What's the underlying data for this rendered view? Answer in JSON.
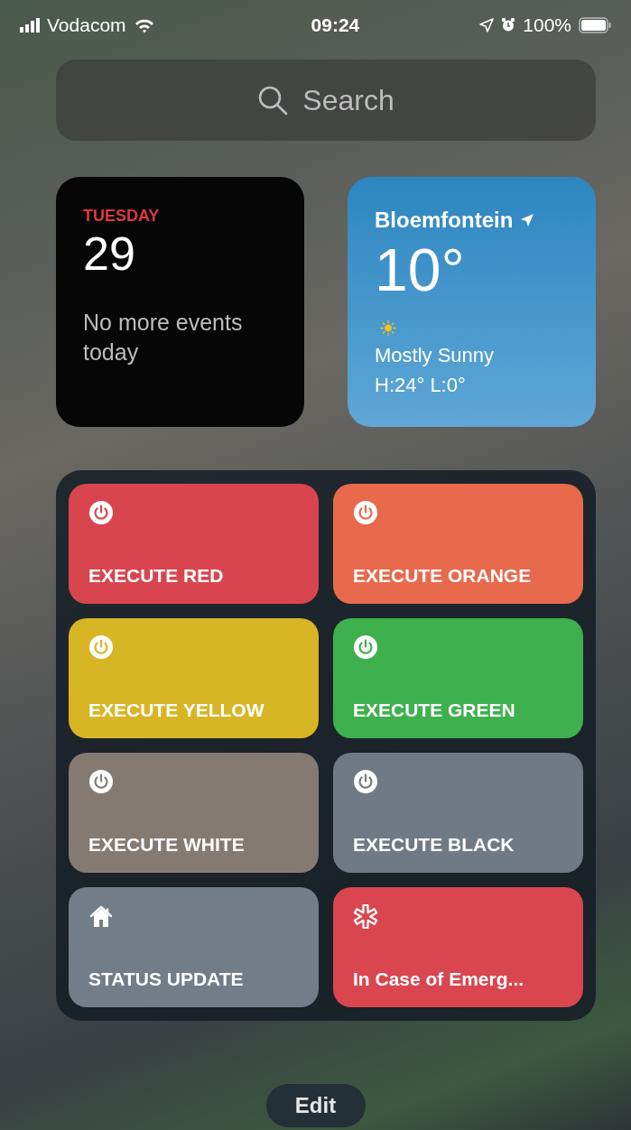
{
  "status_bar": {
    "carrier": "Vodacom",
    "time": "09:24",
    "battery": "100%"
  },
  "search": {
    "placeholder": "Search"
  },
  "calendar": {
    "day": "TUESDAY",
    "date": "29",
    "message": "No more events today"
  },
  "weather": {
    "city": "Bloemfontein",
    "temperature": "10°",
    "condition": "Mostly Sunny",
    "high_low": "H:24° L:0°"
  },
  "shortcuts": [
    {
      "label": "EXECUTE RED",
      "kind": "power",
      "color": "#d9454f"
    },
    {
      "label": "EXECUTE ORANGE",
      "kind": "power",
      "color": "#e8694c"
    },
    {
      "label": "EXECUTE YELLOW",
      "kind": "power",
      "color": "#d8b524"
    },
    {
      "label": "EXECUTE GREEN",
      "kind": "power",
      "color": "#3fb04e"
    },
    {
      "label": "EXECUTE WHITE",
      "kind": "power",
      "color": "#857a72"
    },
    {
      "label": "EXECUTE BLACK",
      "kind": "power",
      "color": "#6f7a85"
    },
    {
      "label": "STATUS UPDATE",
      "kind": "home",
      "color": "#727d88"
    },
    {
      "label": "In Case of Emerg...",
      "kind": "asterisk",
      "color": "#d9464f"
    }
  ],
  "edit_button": "Edit"
}
